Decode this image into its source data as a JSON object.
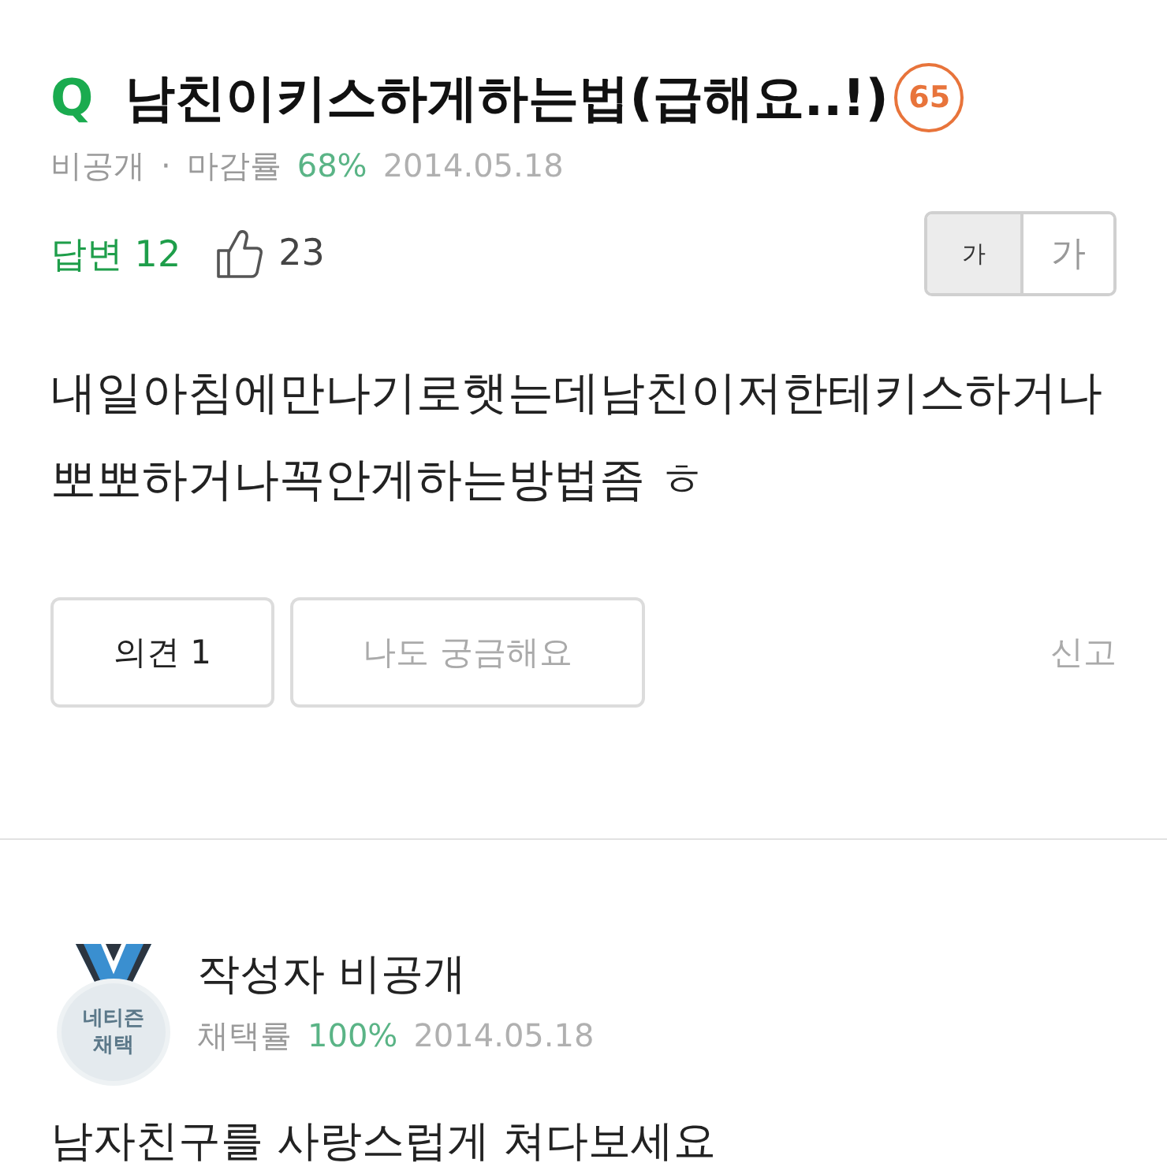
{
  "question": {
    "mark": "Q",
    "title": "남친이키스하게하는법(급해요..!)",
    "badge": "65",
    "meta": {
      "author": "비공개",
      "separator": "·",
      "rate_label": "마감률",
      "rate": "68%",
      "date": "2014.05.18"
    },
    "stats": {
      "answers": "답변 12",
      "likes": "23"
    },
    "font_size_buttons": [
      {
        "label": "가",
        "kind": "small",
        "selected": true
      },
      {
        "label": "가",
        "kind": "large",
        "selected": false
      }
    ],
    "body": "내일아침에만나기로햇는데남친이저한테키스하거나뽀뽀하거나꼭안게하는방법좀 ㅎ",
    "actions": [
      {
        "label": "의견 1",
        "kind": "comment"
      },
      {
        "label": "나도 궁금해요",
        "kind": "curious"
      }
    ],
    "report": "신고"
  },
  "answer": {
    "medal": "네티즌 채택",
    "author": "작성자 비공개",
    "rate_label": "채택률",
    "rate": "100%",
    "date": "2014.05.18",
    "body": "남자친구를 사랑스럽게 쳐다보세요"
  }
}
